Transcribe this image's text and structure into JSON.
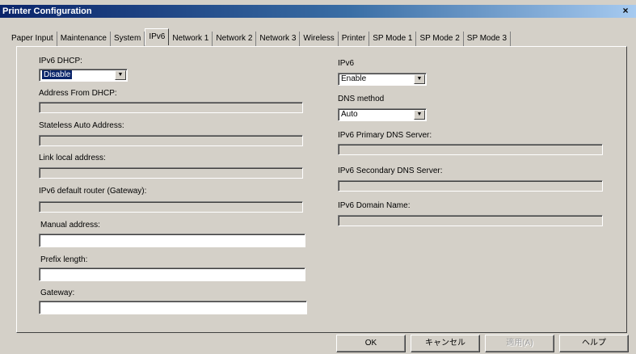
{
  "window": {
    "title": "Printer Configuration",
    "close_glyph": "×"
  },
  "tabs": [
    {
      "label": "Paper Input"
    },
    {
      "label": "Maintenance"
    },
    {
      "label": "System"
    },
    {
      "label": "IPv6",
      "active": true
    },
    {
      "label": "Network 1"
    },
    {
      "label": "Network 2"
    },
    {
      "label": "Network 3"
    },
    {
      "label": "Wireless"
    },
    {
      "label": "Printer"
    },
    {
      "label": "SP Mode 1"
    },
    {
      "label": "SP Mode 2"
    },
    {
      "label": "SP Mode 3"
    }
  ],
  "left": {
    "ipv6_dhcp_label": "IPv6 DHCP:",
    "ipv6_dhcp_value": "Disable",
    "address_from_dhcp_label": "Address From DHCP:",
    "address_from_dhcp_value": "",
    "stateless_label": "Stateless Auto Address:",
    "stateless_value": "",
    "link_local_label": "Link local address:",
    "link_local_value": "",
    "default_router_label": "IPv6 default router (Gateway):",
    "default_router_value": "",
    "manual_address_label": "Manual address:",
    "manual_address_value": "",
    "prefix_length_label": "Prefix length:",
    "prefix_length_value": "",
    "gateway_label": "Gateway:",
    "gateway_value": ""
  },
  "right": {
    "ipv6_label": "IPv6",
    "ipv6_value": "Enable",
    "dns_method_label": "DNS  method",
    "dns_method_value": "Auto",
    "primary_dns_label": "IPv6 Primary DNS Server:",
    "primary_dns_value": "",
    "secondary_dns_label": "IPv6 Secondary DNS Server:",
    "secondary_dns_value": "",
    "domain_name_label": "IPv6 Domain Name:",
    "domain_name_value": ""
  },
  "buttons": {
    "ok": "OK",
    "cancel": "キャンセル",
    "apply": "適用(A)",
    "help": "ヘルプ"
  },
  "icons": {
    "dropdown_arrow": "▼"
  }
}
